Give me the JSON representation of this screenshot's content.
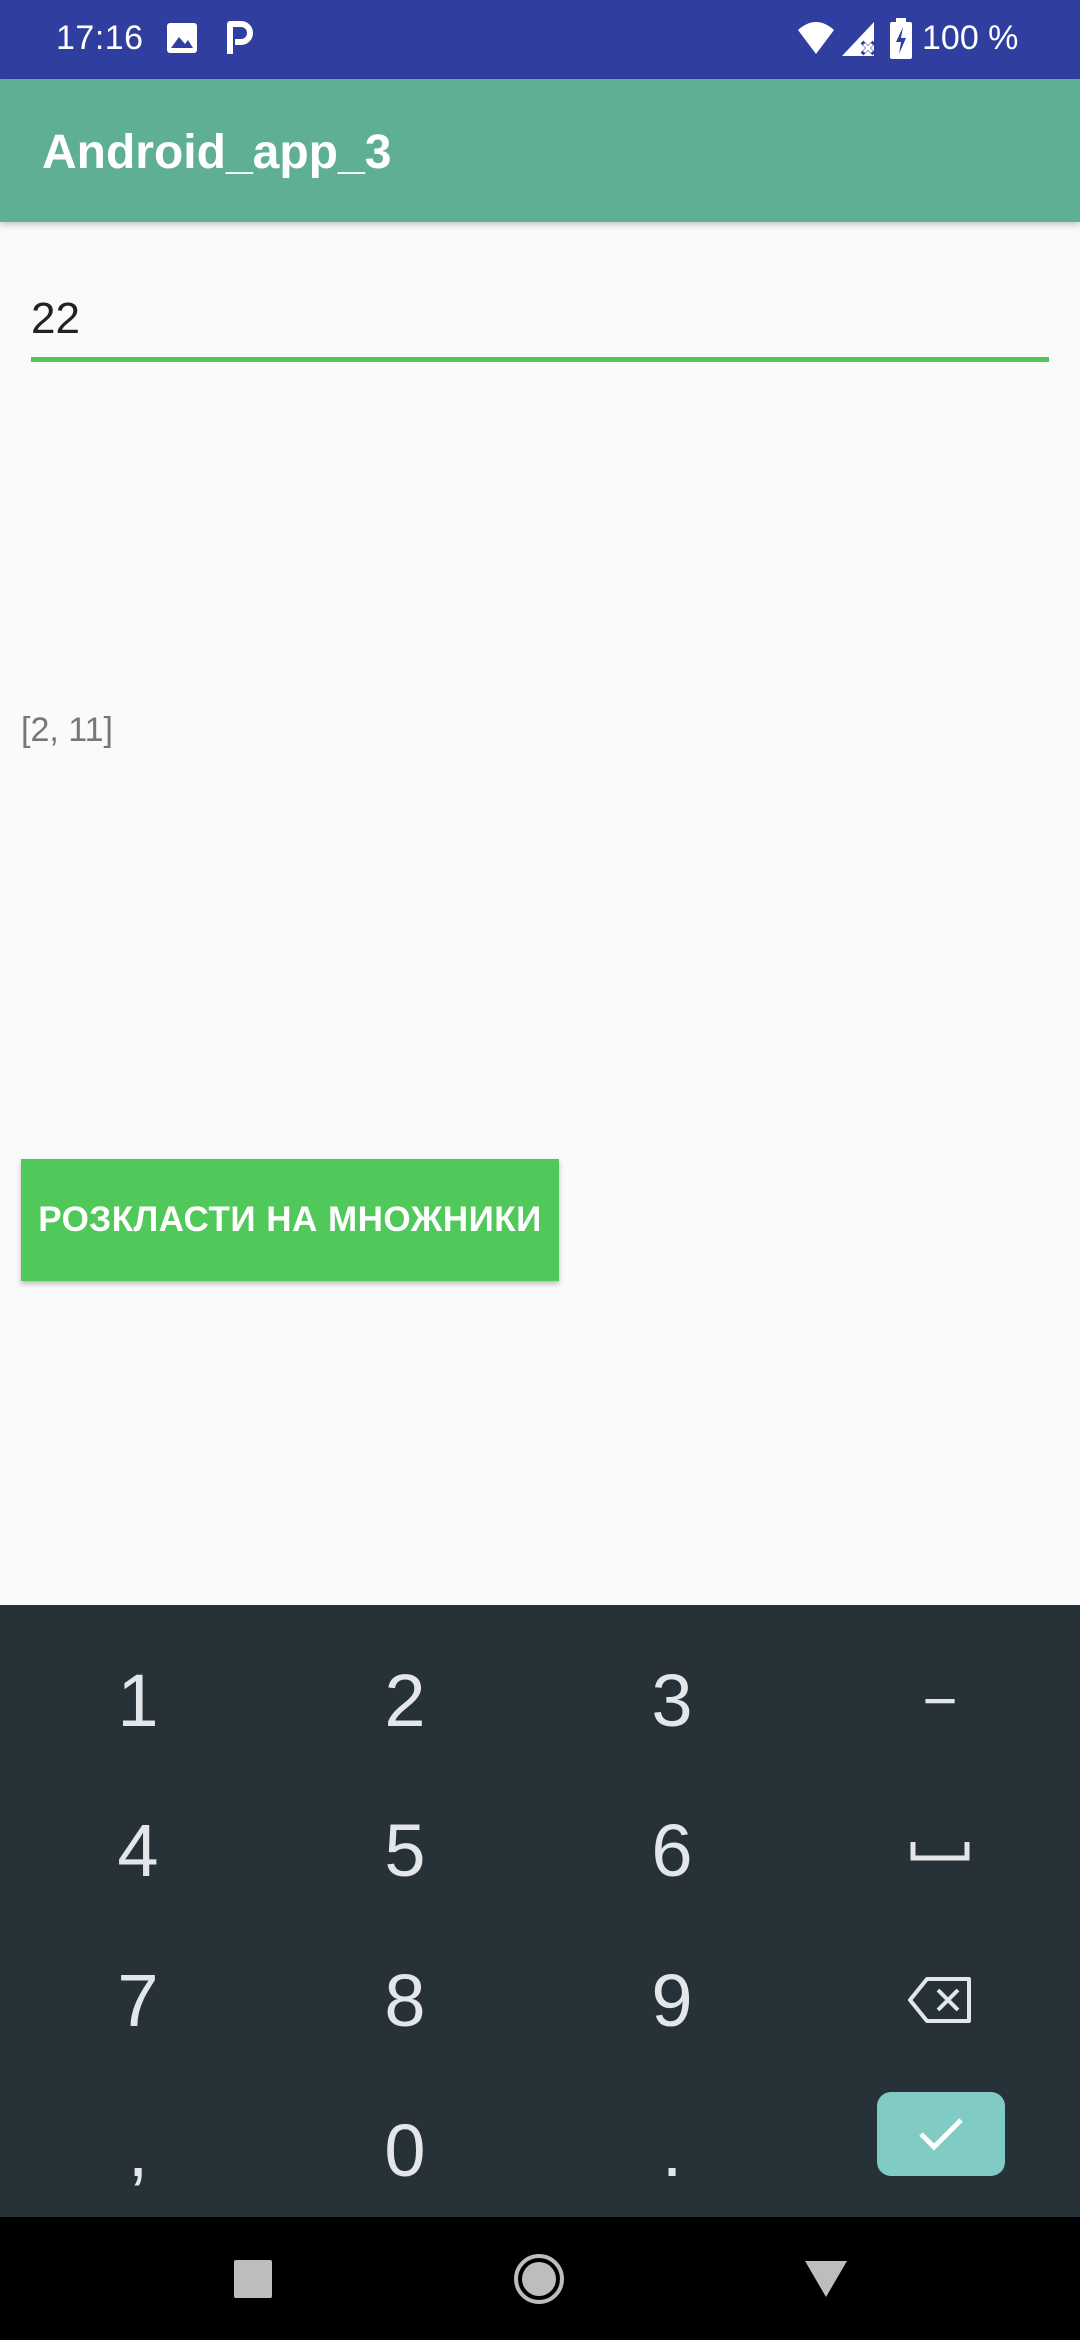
{
  "status_bar": {
    "time": "17:16",
    "battery_percent": "100 %",
    "icons": [
      "image-icon",
      "parking-icon",
      "wifi-icon",
      "signal-icon",
      "battery-icon"
    ]
  },
  "app_bar": {
    "title": "Android_app_3"
  },
  "main": {
    "input_value": "22",
    "result": "[2, 11]",
    "button_label": "РОЗКЛАСТИ НА МНОЖНИКИ"
  },
  "keyboard": {
    "rows": [
      [
        "1",
        "2",
        "3",
        "−"
      ],
      [
        "4",
        "5",
        "6",
        "space"
      ],
      [
        "7",
        "8",
        "9",
        "backspace"
      ],
      [
        ",",
        "0",
        ".",
        "enter"
      ]
    ],
    "keys": {
      "k1": "1",
      "k2": "2",
      "k3": "3",
      "minus": "−",
      "k4": "4",
      "k5": "5",
      "k6": "6",
      "k7": "7",
      "k8": "8",
      "k9": "9",
      "comma": ",",
      "k0": "0",
      "dot": "."
    }
  },
  "colors": {
    "status_bar": "#303F9F",
    "app_bar": "#5FB092",
    "accent": "#51C95A",
    "keyboard_bg": "#263238",
    "enter_key": "#80CBC4"
  }
}
